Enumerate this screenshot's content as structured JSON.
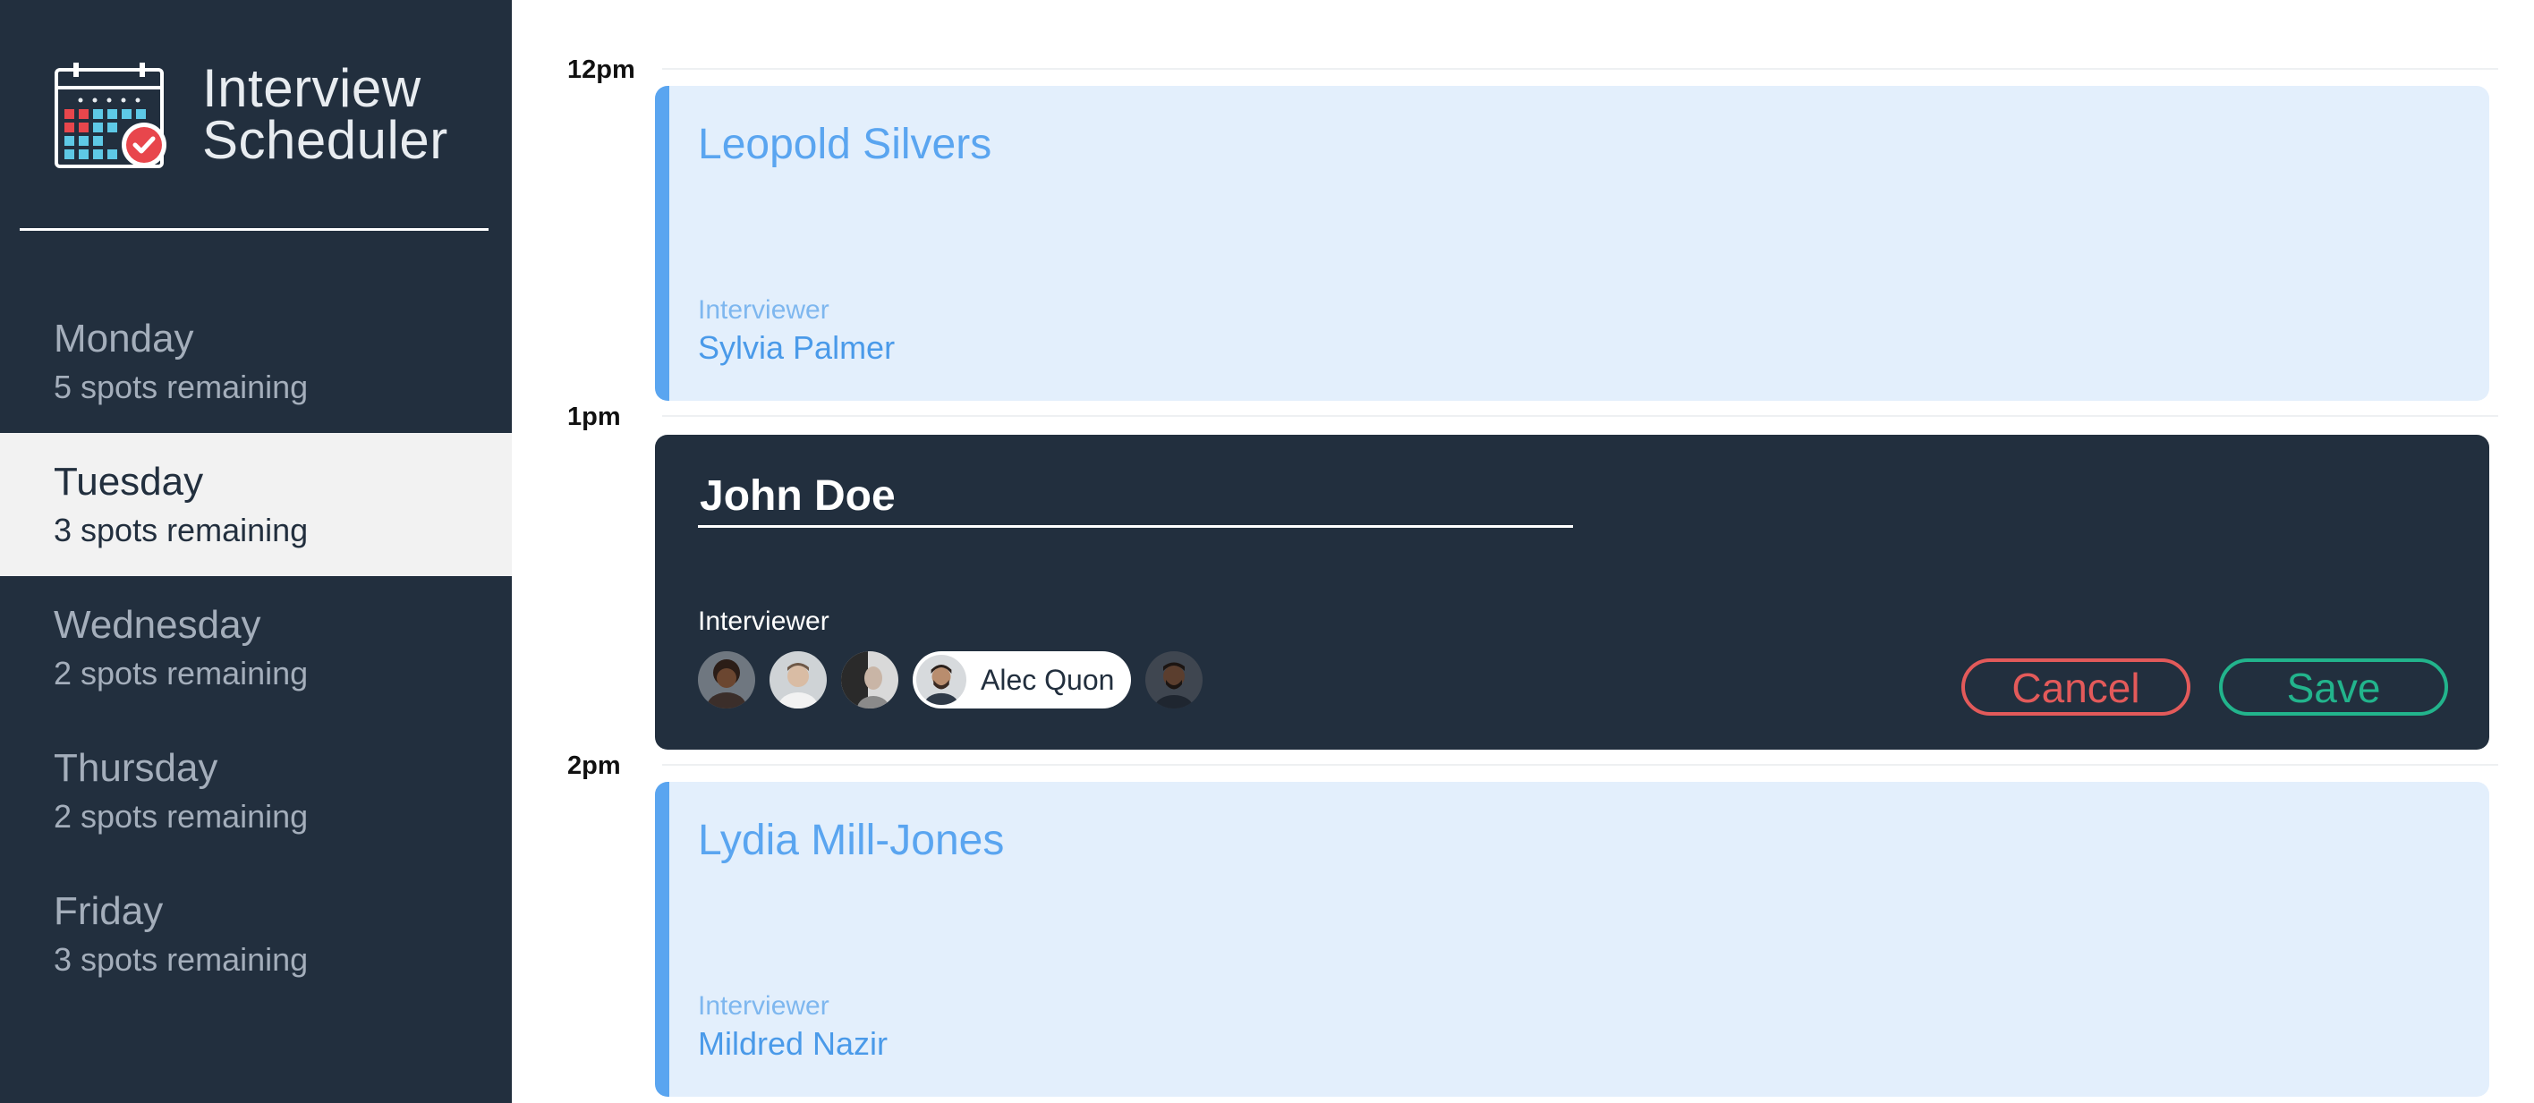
{
  "app": {
    "title_line1": "Interview",
    "title_line2": "Scheduler",
    "colors": {
      "sidebar": "#222f3e",
      "accent_blue": "#5aa5f0",
      "cancel_red": "#e35a5a",
      "save_green": "#22b48c"
    }
  },
  "days": [
    {
      "name": "Monday",
      "spots": "5 spots remaining",
      "selected": false
    },
    {
      "name": "Tuesday",
      "spots": "3 spots remaining",
      "selected": true
    },
    {
      "name": "Wednesday",
      "spots": "2 spots remaining",
      "selected": false
    },
    {
      "name": "Thursday",
      "spots": "2 spots remaining",
      "selected": false
    },
    {
      "name": "Friday",
      "spots": "3 spots remaining",
      "selected": false
    }
  ],
  "appointments": [
    {
      "time": "12pm",
      "student": "Leopold Silvers",
      "interviewer_label": "Interviewer",
      "interviewer": "Sylvia Palmer"
    },
    {
      "time": "1pm",
      "student_input_value": "John Doe",
      "interviewer_label": "Interviewer",
      "selected_interviewer": "Alec Quon",
      "cancel_label": "Cancel",
      "save_label": "Save"
    },
    {
      "time": "2pm",
      "student": "Lydia Mill-Jones",
      "interviewer_label": "Interviewer",
      "interviewer": "Mildred Nazir"
    }
  ],
  "icons": {
    "logo": "calendar-check-icon"
  }
}
